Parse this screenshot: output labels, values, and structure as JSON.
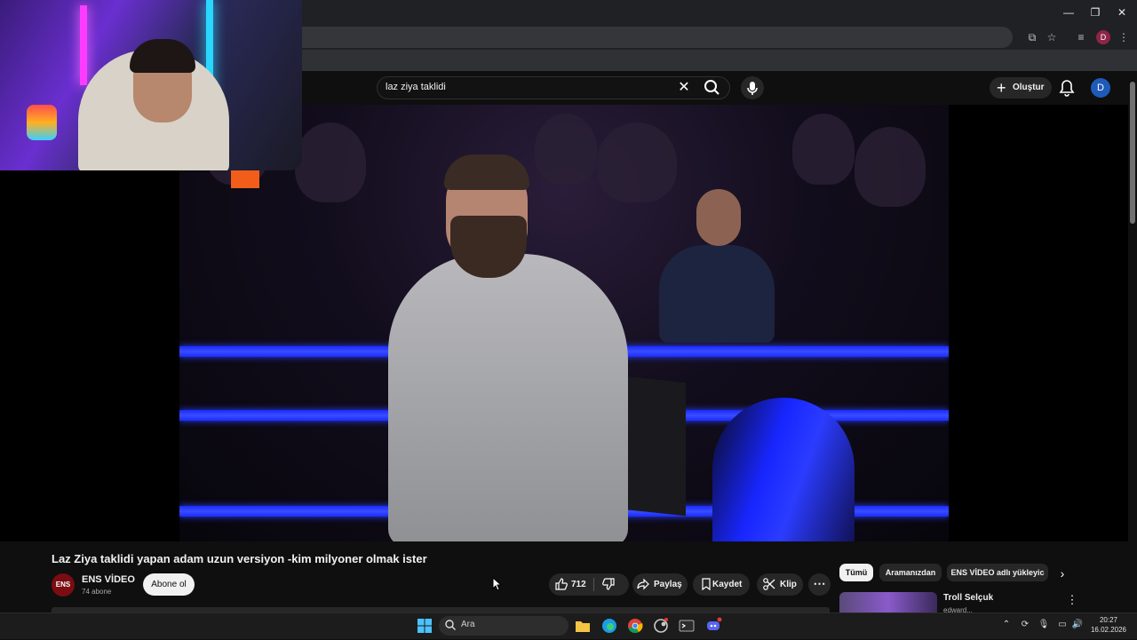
{
  "search": {
    "query": "laz ziya taklidi"
  },
  "header": {
    "create_label": "Oluştur",
    "avatar_letter": "D"
  },
  "browser": {
    "profile_letter": "D"
  },
  "video": {
    "title": "Laz Ziya taklidi yapan adam uzun versiyon -kim milyoner olmak ister",
    "channel_avatar_text": "ENS",
    "channel_name": "ENS VİDEO",
    "subscribers": "74 abone",
    "subscribe_label": "Abone ol",
    "likes": "712",
    "share_label": "Paylaş",
    "save_label": "Kaydet",
    "clip_label": "Klip",
    "more_label": "⋯"
  },
  "chips": [
    {
      "label": "Tümü",
      "selected": true
    },
    {
      "label": "Aramanızdan",
      "selected": false
    },
    {
      "label": "ENS VİDEO adlı yükleyic",
      "selected": false
    }
  ],
  "recommendation": {
    "title": "Troll Selçuk",
    "channel": "edward..."
  },
  "taskbar": {
    "search_placeholder": "Ara",
    "time": "20:27",
    "date": "16.02.2026",
    "apps": [
      "windows-start",
      "file-explorer",
      "edge",
      "chrome",
      "steam",
      "terminal",
      "discord"
    ]
  },
  "colors": {
    "background": "#0f0f0f",
    "pill": "#272727",
    "accent_blue": "#1a2bff",
    "avatar": "#1e5bb8"
  }
}
